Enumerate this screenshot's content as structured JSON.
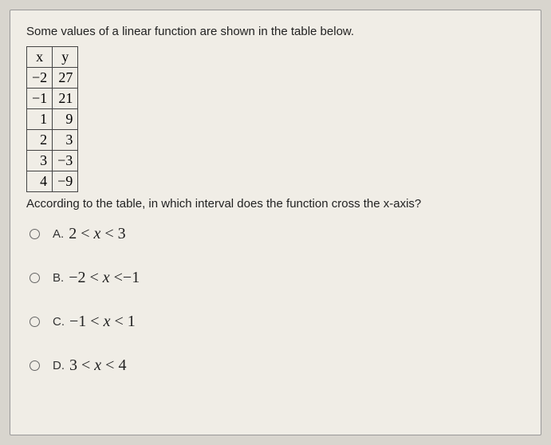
{
  "question": {
    "intro": "Some values of a linear function are shown in the table below.",
    "followup": "According to the table, in which interval does the function cross the x-axis?"
  },
  "table": {
    "headers": [
      "x",
      "y"
    ],
    "rows": [
      [
        "−2",
        "27"
      ],
      [
        "−1",
        "21"
      ],
      [
        "1",
        "9"
      ],
      [
        "2",
        "3"
      ],
      [
        "3",
        "−3"
      ],
      [
        "4",
        "−9"
      ]
    ]
  },
  "options": {
    "a": {
      "label": "A.",
      "math_html": "2 < <span class='italic-x'>x</span> < 3"
    },
    "b": {
      "label": "B.",
      "math_html": "−2 < <span class='italic-x'>x</span> <−1"
    },
    "c": {
      "label": "C.",
      "math_html": "−1 < <span class='italic-x'>x</span> < 1"
    },
    "d": {
      "label": "D.",
      "math_html": "3 < <span class='italic-x'>x</span> < 4"
    }
  }
}
